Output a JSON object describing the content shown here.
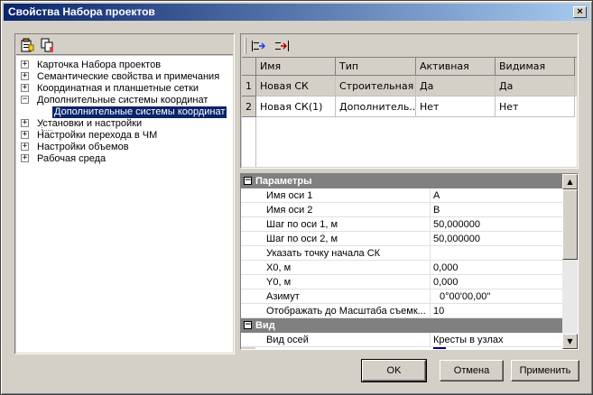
{
  "window": {
    "title": "Свойства Набора проектов",
    "close_label": "×"
  },
  "tree": {
    "items": [
      {
        "label": "Карточка Набора проектов",
        "expander": "+"
      },
      {
        "label": "Семантические свойства и примечания",
        "expander": "+"
      },
      {
        "label": "Координатная и планшетные сетки",
        "expander": "+"
      },
      {
        "label": "Дополнительные системы координат",
        "expander": "−"
      },
      {
        "label": "Дополнительные системы координат",
        "selected": true
      },
      {
        "label": "Установки и настройки",
        "expander": "+"
      },
      {
        "label": "Настройки перехода в ЧМ",
        "expander": "+"
      },
      {
        "label": "Настройки объемов",
        "expander": "+"
      },
      {
        "label": "Рабочая среда",
        "expander": "+"
      }
    ]
  },
  "grid": {
    "headers": [
      "Имя",
      "Тип",
      "Активная",
      "Видимая"
    ],
    "rows": [
      {
        "num": "1",
        "cells": [
          "Новая СК",
          "Строительная",
          "Да",
          "Да"
        ]
      },
      {
        "num": "2",
        "cells": [
          "Новая СК(1)",
          "Дополнитель...",
          "Нет",
          "Нет"
        ]
      }
    ]
  },
  "props": {
    "categories": [
      {
        "title": "Параметры",
        "rows": [
          {
            "name": "Имя оси 1",
            "value": "A"
          },
          {
            "name": "Имя оси 2",
            "value": "B"
          },
          {
            "name": "Шаг по оси 1, м",
            "value": "50,000000"
          },
          {
            "name": "Шаг по оси 2, м",
            "value": "50,000000"
          },
          {
            "name": "Указать точку начала СК",
            "value": ""
          },
          {
            "name": "X0, м",
            "value": "0,000"
          },
          {
            "name": "Y0, м",
            "value": "0,000"
          },
          {
            "name": "Азимут",
            "value": "0°00'00,00\""
          },
          {
            "name": "Отображать до Масштаба съемк...",
            "value": "10"
          }
        ]
      },
      {
        "title": "Вид",
        "rows": [
          {
            "name": "Вид осей",
            "value": "Кресты в узлах"
          }
        ]
      }
    ]
  },
  "buttons": {
    "ok": "OK",
    "cancel": "Отмена",
    "apply": "Применить"
  },
  "colors": {
    "title_start": "#0a246a",
    "title_end": "#a6caf0",
    "face": "#d4d0c8",
    "selection": "#0a246a"
  }
}
